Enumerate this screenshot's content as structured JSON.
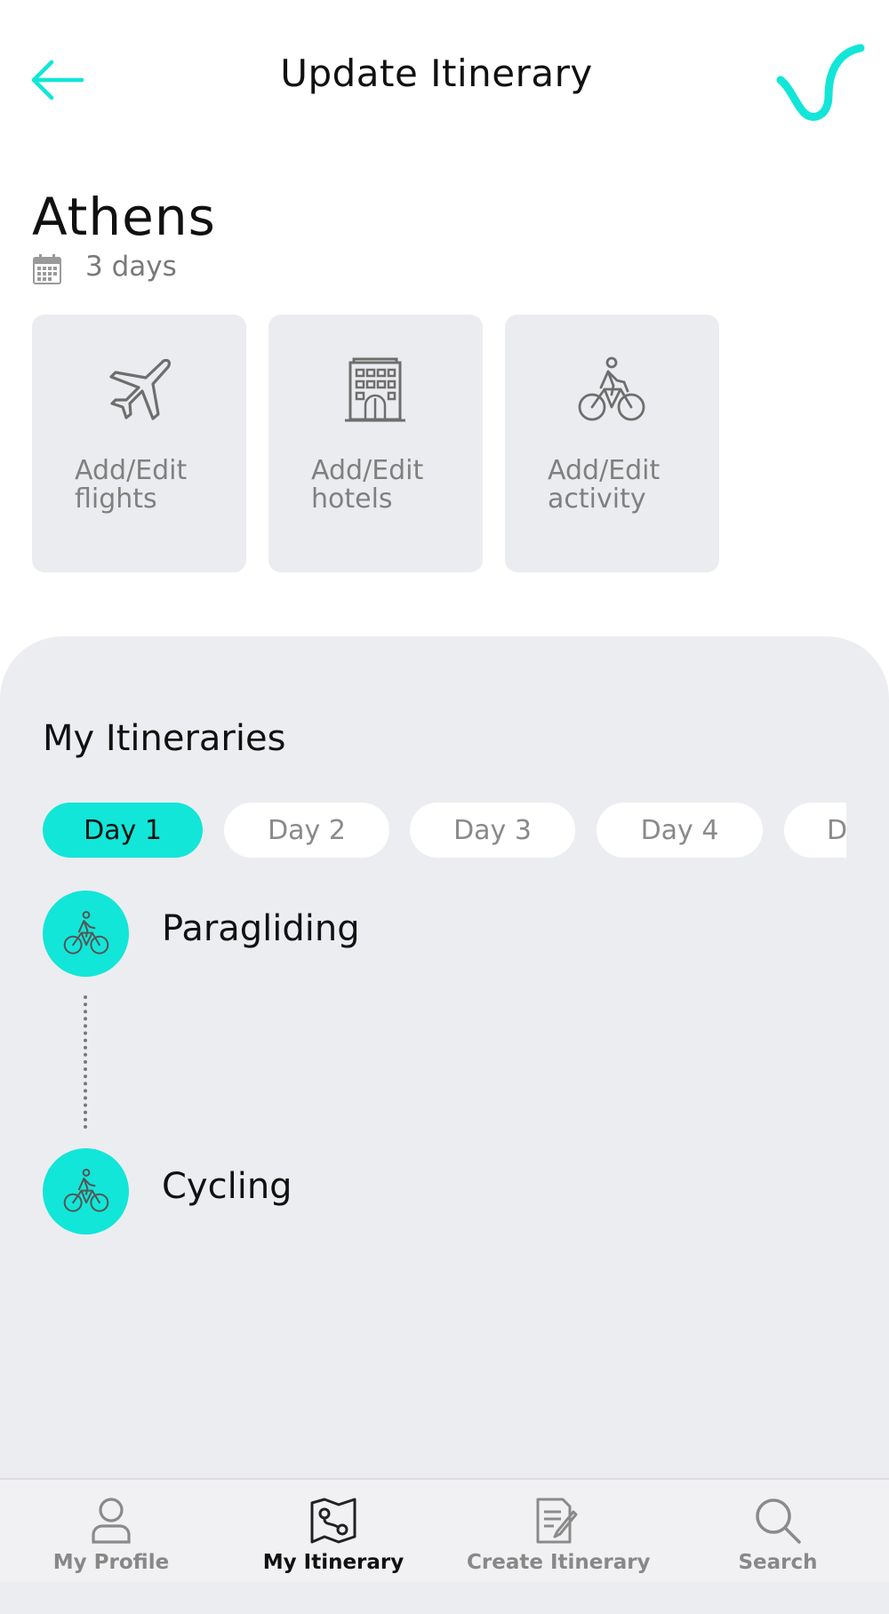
{
  "header": {
    "title": "Update Itinerary",
    "back_icon": "back-arrow-icon",
    "logo_icon": "check-swoosh-logo"
  },
  "destination": {
    "city": "Athens",
    "duration": "3 days",
    "calendar_icon": "calendar-icon"
  },
  "actions": [
    {
      "label": "Add/Edit flights",
      "icon": "airplane-icon"
    },
    {
      "label": "Add/Edit hotels",
      "icon": "hotel-building-icon"
    },
    {
      "label": "Add/Edit activity",
      "icon": "cyclist-icon"
    }
  ],
  "itineraries": {
    "title": "My Itineraries",
    "day_tabs": [
      {
        "label": "Day 1",
        "active": true
      },
      {
        "label": "Day 2",
        "active": false
      },
      {
        "label": "Day 3",
        "active": false
      },
      {
        "label": "Day 4",
        "active": false
      },
      {
        "label": "D",
        "active": false
      }
    ],
    "activities": [
      {
        "name": "Paragliding",
        "icon": "cyclist-icon"
      },
      {
        "name": "Cycling",
        "icon": "cyclist-icon"
      }
    ]
  },
  "tabbar": {
    "items": [
      {
        "label": "My Profile",
        "icon": "user-icon",
        "active": false
      },
      {
        "label": "My Itinerary",
        "icon": "map-icon",
        "active": true
      },
      {
        "label": "Create Itinerary",
        "icon": "document-edit-icon",
        "active": false
      },
      {
        "label": "Search",
        "icon": "search-icon",
        "active": false
      }
    ]
  },
  "colors": {
    "accent": "#12e6d8",
    "card_bg": "#ebecef",
    "panel_bg": "#ecedf1",
    "muted_text": "#808080"
  }
}
